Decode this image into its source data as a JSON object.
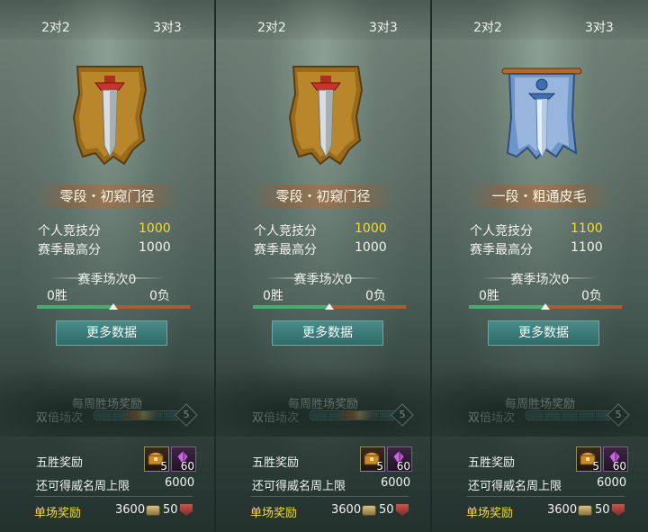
{
  "panels": [
    {
      "tabs": [
        "2对2",
        "3对3"
      ],
      "rank_name": "零段・初窥门径",
      "emblem": "gold-sword-banner-icon",
      "personal_score_label": "个人竞技分",
      "personal_score": "1000",
      "season_best_label": "赛季最高分",
      "season_best": "1000",
      "season_matches": "赛季场次0",
      "wins": "0胜",
      "losses": "0负",
      "win_ratio": 0.5,
      "more_button": "更多数据",
      "weekly_title": "每周胜场奖励",
      "double_label": "双倍场次",
      "double_count": "5",
      "double_progress_fire": true,
      "five_win_label": "五胜奖励",
      "chest_count": "5",
      "gem_count": "60",
      "cap_label": "还可得威名周上限",
      "cap_value": "6000",
      "single_label": "单场奖励",
      "single_value_1": "3600",
      "single_value_2": "50"
    },
    {
      "tabs": [
        "2对2",
        "3对3"
      ],
      "rank_name": "零段・初窥门径",
      "emblem": "gold-sword-banner-icon",
      "personal_score_label": "个人竞技分",
      "personal_score": "1000",
      "season_best_label": "赛季最高分",
      "season_best": "1000",
      "season_matches": "赛季场次0",
      "wins": "0胜",
      "losses": "0负",
      "win_ratio": 0.5,
      "more_button": "更多数据",
      "weekly_title": "每周胜场奖励",
      "double_label": "双倍场次",
      "double_count": "5",
      "double_progress_fire": true,
      "five_win_label": "五胜奖励",
      "chest_count": "5",
      "gem_count": "60",
      "cap_label": "还可得威名周上限",
      "cap_value": "6000",
      "single_label": "单场奖励",
      "single_value_1": "3600",
      "single_value_2": "50"
    },
    {
      "tabs": [
        "2对2",
        "3对3"
      ],
      "rank_name": "一段・粗通皮毛",
      "emblem": "blue-sword-banner-icon",
      "personal_score_label": "个人竞技分",
      "personal_score": "1100",
      "season_best_label": "赛季最高分",
      "season_best": "1100",
      "season_matches": "赛季场次0",
      "wins": "0胜",
      "losses": "0负",
      "win_ratio": 0.5,
      "more_button": "更多数据",
      "weekly_title": "每周胜场奖励",
      "double_label": "双倍场次",
      "double_count": "5",
      "double_progress_fire": false,
      "five_win_label": "五胜奖励",
      "chest_count": "5",
      "gem_count": "60",
      "cap_label": "还可得威名周上限",
      "cap_value": "6000",
      "single_label": "单场奖励",
      "single_value_1": "3600",
      "single_value_2": "50"
    }
  ],
  "colors": {
    "gold_text": "#f3dc3a",
    "win_bar": "#4caa6e",
    "loss_bar": "#b0583a",
    "button": "#2f6a68"
  }
}
